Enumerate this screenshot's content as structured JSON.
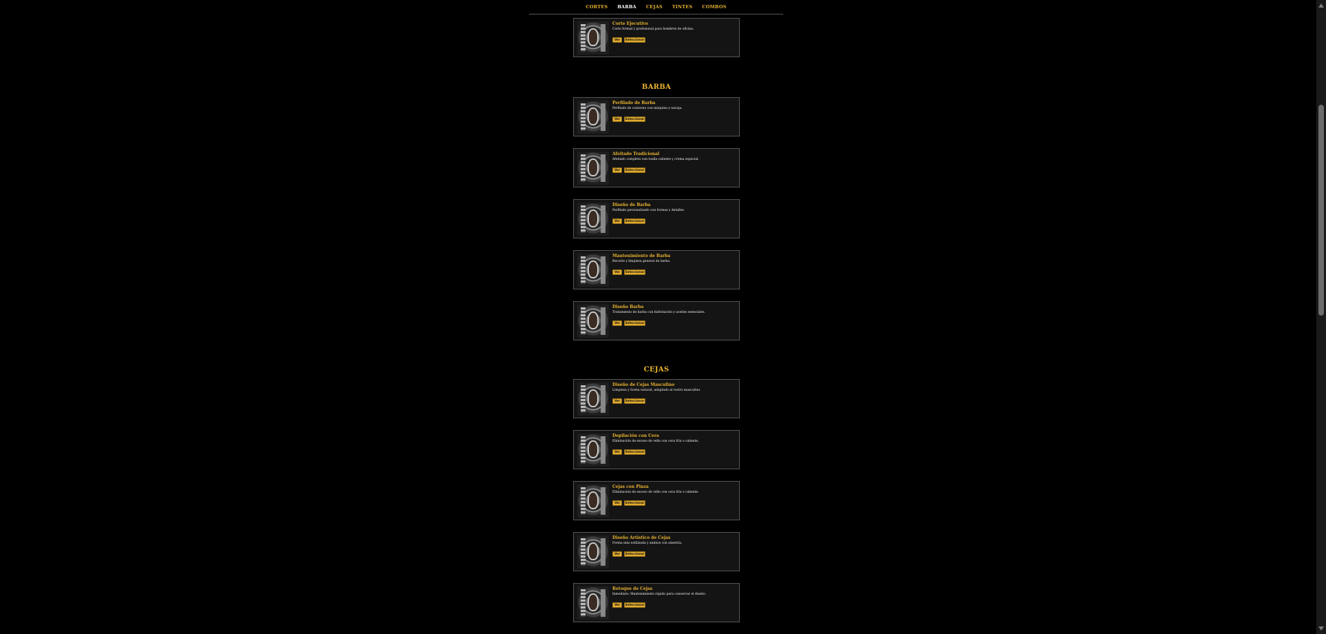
{
  "nav": {
    "items": [
      "CORTES",
      "BARBA",
      "CEJAS",
      "TINTES",
      "COMBOS"
    ],
    "active": "BARBA"
  },
  "buttons": {
    "view_label": "Ver",
    "select_label": "Seleccionar"
  },
  "sections": [
    {
      "title": "",
      "cards": [
        {
          "name": "Corte Ejecutivo",
          "desc": "Corte formal y profesional para hombres de oficina."
        }
      ]
    },
    {
      "title": "BARBA",
      "cards": [
        {
          "name": "Perfilado de Barba",
          "desc": "Perfilado de contorno con máquina y navaja."
        },
        {
          "name": "Afeitado Tradicional",
          "desc": "Afeitado completo con toalla caliente y crema especial."
        },
        {
          "name": "Diseño de Barba",
          "desc": "Perfilado personalizado con formas y detalles."
        },
        {
          "name": "Mantenimiento de Barba",
          "desc": "Recorte y limpieza general de barba."
        },
        {
          "name": "Diseño Barba",
          "desc": "Tratamiento de barba con hidratación y aceites esenciales."
        }
      ]
    },
    {
      "title": "CEJAS",
      "cards": [
        {
          "name": "Diseño de Cejas Masculino",
          "desc": "Limpieza y forma natural, adaptado al rostro masculino."
        },
        {
          "name": "Depilación con Cera",
          "desc": "Eliminación de exceso de vello con cera fría o caliente."
        },
        {
          "name": "Cejas con Pinza",
          "desc": "Eliminación de exceso de vello con cera fría o caliente."
        },
        {
          "name": "Diseño Artístico de Cejas",
          "desc": "Forma más estilizada y ambios con simetría."
        },
        {
          "name": "Retoque de Cejas",
          "desc": "Inmediato: Mantenimiento rápido para conservar el diseño."
        }
      ]
    }
  ]
}
